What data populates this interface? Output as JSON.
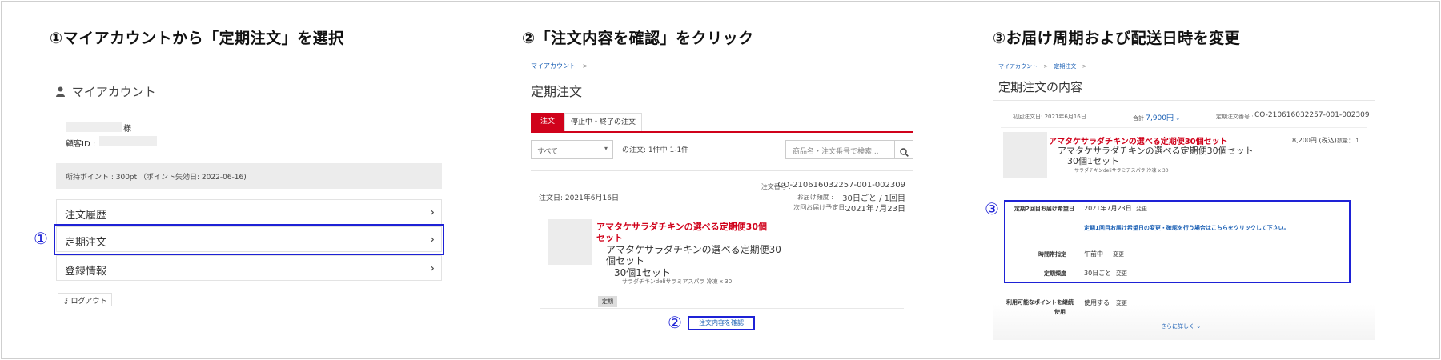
{
  "steps": {
    "step1_title": "①マイアカウントから「定期注文」を選択",
    "step2_title": "②「注文内容を確認」をクリック",
    "step3_title": "③お届け周期および配送日時を変更"
  },
  "markers": {
    "m1": "①",
    "m2": "②",
    "m3": "③"
  },
  "account": {
    "title": "マイアカウント",
    "name_suffix": "様",
    "customer_id_label": "顧客ID :",
    "points_text": "所持ポイント : 300pt （ポイント失効日: 2022-06-16)",
    "menu": [
      {
        "label": "注文履歴"
      },
      {
        "label": "定期注文"
      },
      {
        "label": "登録情報"
      }
    ],
    "logout_label": "ログアウト"
  },
  "orders": {
    "breadcrumb": "マイアカウント",
    "breadcrumb_sep": ">",
    "page_title": "定期注文",
    "tab_active": "注文",
    "tab_inactive": "停止中・終了の注文",
    "filter_value": "すべて",
    "count_text": "の注文: 1件中 1-1件",
    "search_placeholder": "商品名・注文番号で検索...",
    "order_number_label": "注文番号 :",
    "order_number": "CO-210616032257-001-002309",
    "order_date": "注文日: 2021年6月16日",
    "frequency_label": "お届け頻度 :",
    "frequency": "30日ごと / 1回目",
    "next_date_label": "次回お届け予定日:",
    "next_date": "2021年7月23日",
    "product_name_1": "アマタケサラダチキンの選べる定期便30個",
    "product_name_2": "セット",
    "product_sub_1": "アマタケサラダチキンの選べる定期便30",
    "product_sub_2": "個セット",
    "product_sub_3": "30個1セット",
    "product_option": "サラダチキンdeliサラミアスパラ 冷凍 x 30",
    "badge": "定期",
    "confirm_button": "注文内容を確認"
  },
  "detail": {
    "breadcrumb_1": "マイアカウント",
    "breadcrumb_2": "定期注文",
    "breadcrumb_sep": ">",
    "page_title": "定期注文の内容",
    "first_order_date": "初回注文日: 2021年6月16日",
    "total_label": "合計",
    "total_value": "7,900円",
    "total_chevron": "⌄",
    "order_number_label": "定期注文番号 :",
    "order_number": "CO-210616032257-001-002309",
    "product_name": "アマタケサラダチキンの選べる定期便30個セット",
    "product_sub_1": "アマタケサラダチキンの選べる定期便30個セット",
    "product_sub_2": "30個1セット",
    "product_option": "サラダチキンdeliサラミアスパラ 冷凍 x 30",
    "price": "8,200円 (税込)",
    "qty": "数量： 1",
    "second_date_label": "定期2回目お届け希望日",
    "second_date_value": "2021年7月23日",
    "change_label": "変更",
    "notice_link": "定期1回目お届け希望日の変更・確認を行う場合はこちらをクリックして下さい。",
    "time_label": "時間帯指定",
    "time_value": "午前中",
    "freq_label": "定期頻度",
    "freq_value": "30日ごと",
    "points_label_1": "利用可能なポイントを継続",
    "points_label_2": "使用",
    "points_value": "使用する",
    "more_link": "さらに詳しく ⌄"
  }
}
